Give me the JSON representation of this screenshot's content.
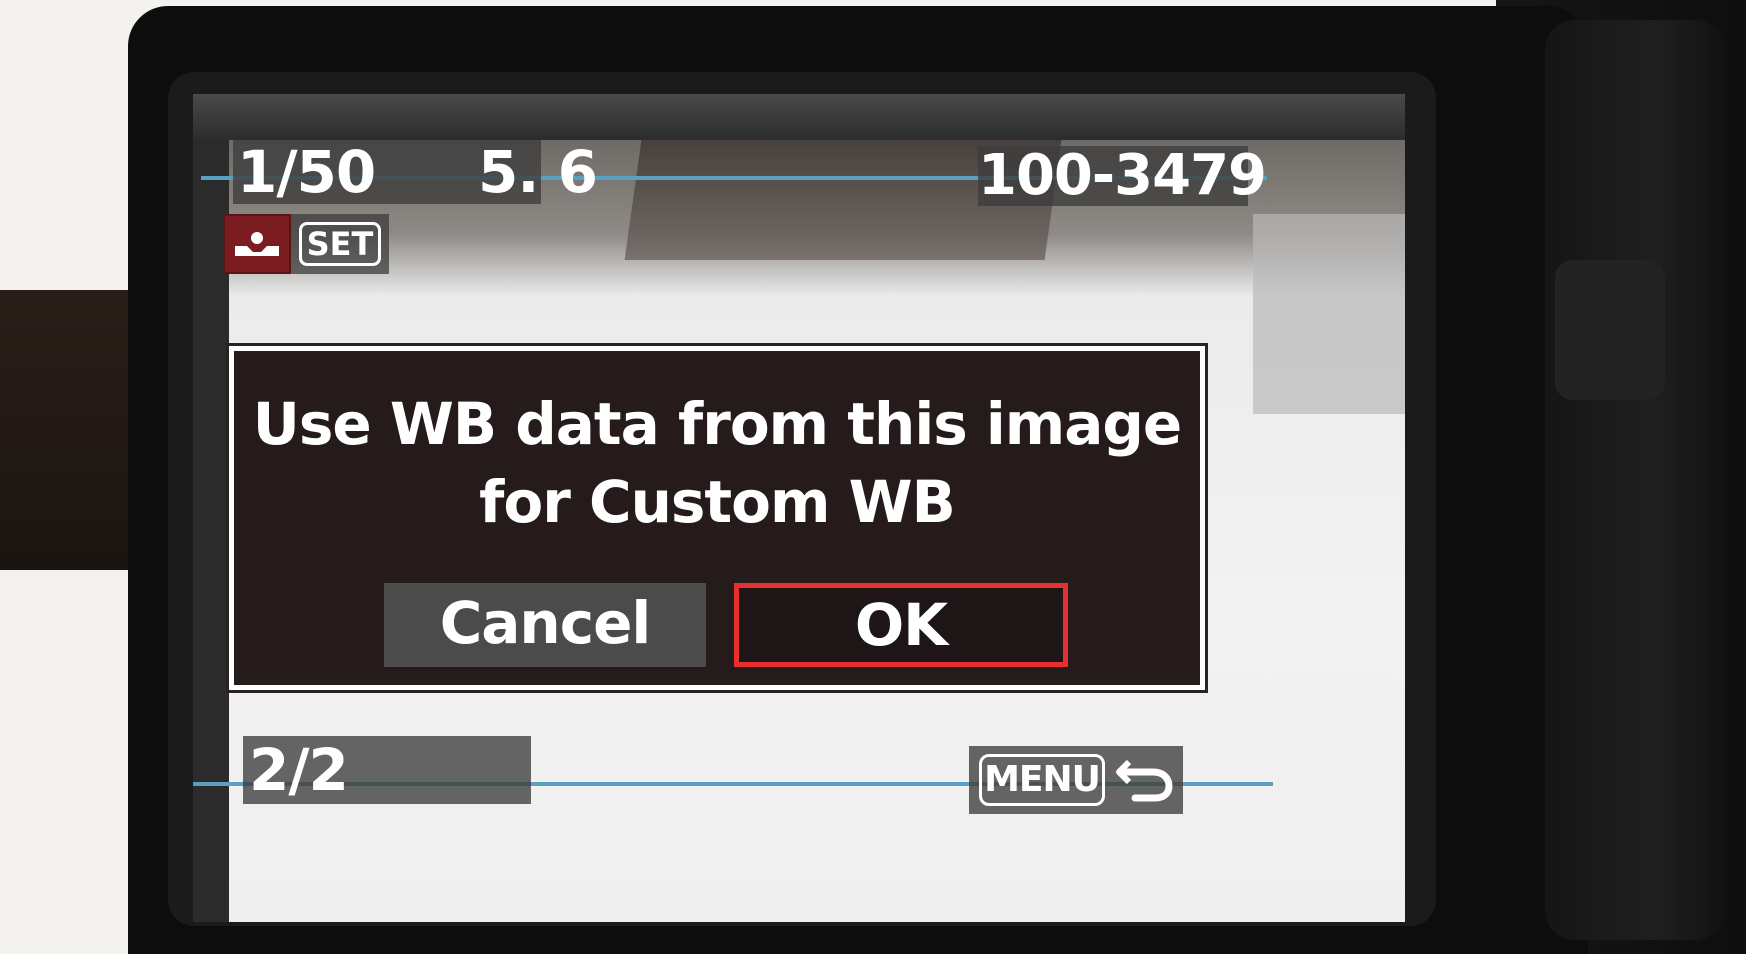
{
  "status": {
    "shutter_speed": "1/50",
    "aperture": "5. 6",
    "file_number": "100-3479",
    "page": "2/2"
  },
  "wb_control": {
    "icon": "custom-white-balance-icon",
    "set_label": "SET"
  },
  "dialog": {
    "message_line1": "Use WB data from this image",
    "message_line2": "for Custom WB",
    "cancel_label": "Cancel",
    "ok_label": "OK",
    "selected": "OK"
  },
  "menu": {
    "label": "MENU",
    "icon": "return-arrow-icon"
  },
  "colors": {
    "selection_border": "#e83030",
    "guide_line": "#5aa0c0",
    "wb_icon_bg": "#7a1c20",
    "dialog_bg": "#241b1a"
  }
}
